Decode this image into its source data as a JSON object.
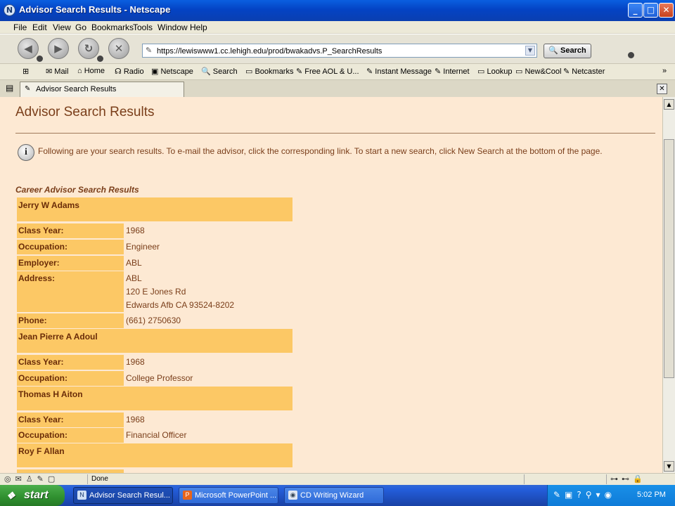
{
  "window": {
    "title": "Advisor Search Results - Netscape",
    "buttons": {
      "minimize": "_",
      "maximize": "□",
      "close": "✕"
    }
  },
  "menu": [
    "File",
    "Edit",
    "View",
    "Go",
    "Bookmarks",
    "Tools",
    "Window",
    "Help"
  ],
  "nav": {
    "url": "https://lewiswww1.cc.lehigh.edu/prod/bwakadvs.P_SearchResults",
    "search_label": "Search",
    "logo_letter": "N"
  },
  "bookmarks": [
    "Mail",
    "Home",
    "Radio",
    "Netscape",
    "Search",
    "Bookmarks",
    "Free AOL & U...",
    "Instant Message",
    "Internet",
    "Lookup",
    "New&Cool",
    "Netcaster"
  ],
  "bookmarks_overflow": "»",
  "tab": {
    "label": "Advisor Search Results",
    "close": "✕"
  },
  "page": {
    "title": "Advisor Search Results",
    "info": "Following are your search results. To e-mail the advisor, click the corresponding link. To start a new search, click New Search at the bottom of the page.",
    "info_icon_glyph": "i",
    "caption": "Career Advisor Search Results",
    "labels": {
      "class_year": "Class Year:",
      "occupation": "Occupation:",
      "employer": "Employer:",
      "address": "Address:",
      "phone": "Phone:"
    },
    "records": [
      {
        "name": "Jerry W Adams",
        "class_year": "1968",
        "occupation": "Engineer",
        "employer": "ABL",
        "address": [
          "ABL",
          "120 E Jones Rd",
          "Edwards Afb CA 93524-8202"
        ],
        "phone": "(661) 2750630"
      },
      {
        "name": "Jean Pierre A Adoul",
        "class_year": "1968",
        "occupation": "College Professor"
      },
      {
        "name": "Thomas H Aiton",
        "class_year": "1968",
        "occupation": "Financial Officer"
      },
      {
        "name": "Roy F Allan"
      }
    ]
  },
  "status": {
    "text": "Done"
  },
  "taskbar": {
    "start": "start",
    "tasks": [
      {
        "label": "Advisor Search Resul...",
        "active": true
      },
      {
        "label": "Microsoft PowerPoint ...",
        "active": false
      },
      {
        "label": "CD Writing Wizard",
        "active": false
      }
    ],
    "clock": "5:02 PM"
  }
}
